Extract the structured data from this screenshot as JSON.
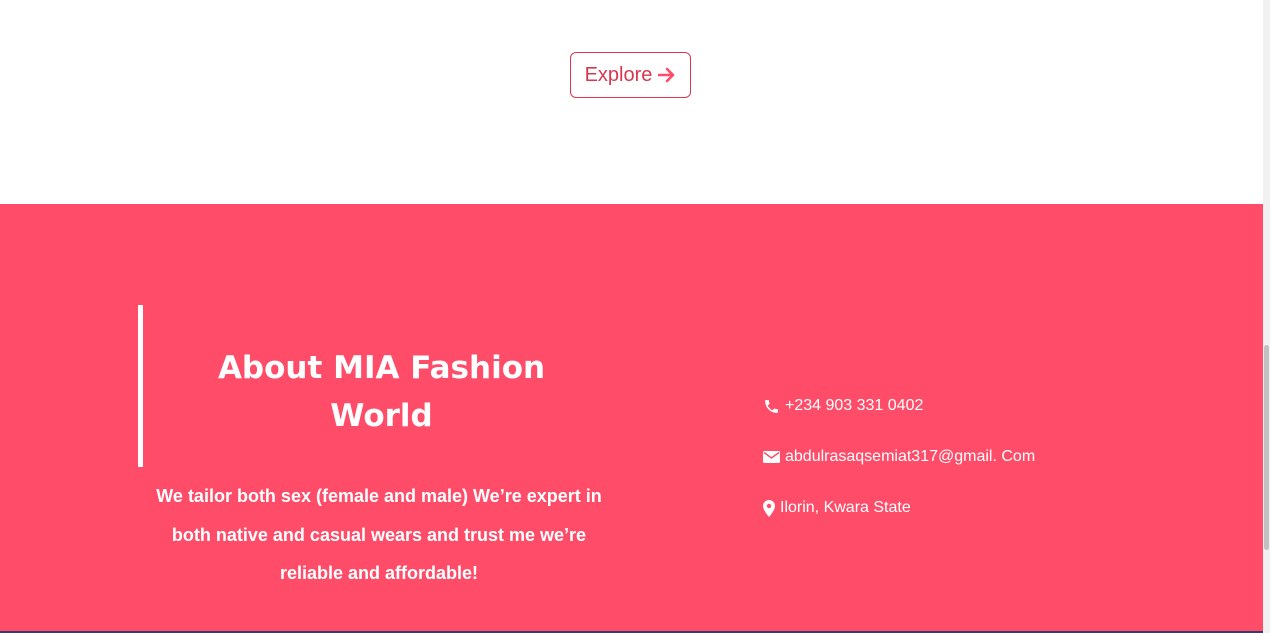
{
  "explore": {
    "label": "Explore",
    "icon": "arrow-right-icon"
  },
  "footer": {
    "background": "#ff4c69",
    "about": {
      "title": "About MIA Fashion World",
      "description": "We tailor both sex (female and male) We’re expert in both native and casual wears and trust me we’re reliable and affordable!"
    },
    "contact": {
      "phone": {
        "icon": "phone-icon",
        "text": "+234 903 331 0402"
      },
      "email": {
        "icon": "envelope-icon",
        "text": "abdulrasaqsemiat317@gmail. Com"
      },
      "location": {
        "icon": "map-marker-icon",
        "text": "Ilorin, Kwara State"
      }
    }
  },
  "colors": {
    "accent": "#d8384f",
    "footer_bg": "#ff4c69"
  }
}
